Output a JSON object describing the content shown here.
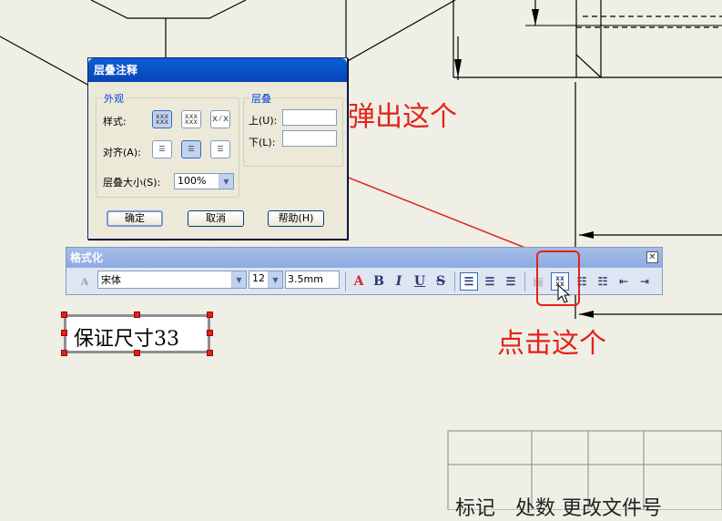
{
  "dialog": {
    "title": "层叠注释",
    "appearance_label": "外观",
    "style_label": "样式:",
    "align_label": "对齐(A):",
    "size_label": "层叠大小(S):",
    "size_value": "100%",
    "stack_label": "层叠",
    "upper_label": "上(U):",
    "lower_label": "下(L):",
    "upper_value": "",
    "lower_value": "",
    "ok_label": "确定",
    "cancel_label": "取消",
    "help_label": "帮助(H)"
  },
  "toolbar": {
    "title": "格式化",
    "font_value": "宋体",
    "size_value": "12",
    "height_value": "3.5mm",
    "color_label": "A",
    "bold_label": "B",
    "italic_label": "I",
    "underline_label": "U",
    "strike_label": "S"
  },
  "note": {
    "text": "保证尺寸33"
  },
  "annotations": {
    "popup": "弹出这个",
    "click": "点击这个",
    "color": "#e2231a"
  },
  "title_block": {
    "row_text": "标记　处数 更改文件号"
  }
}
